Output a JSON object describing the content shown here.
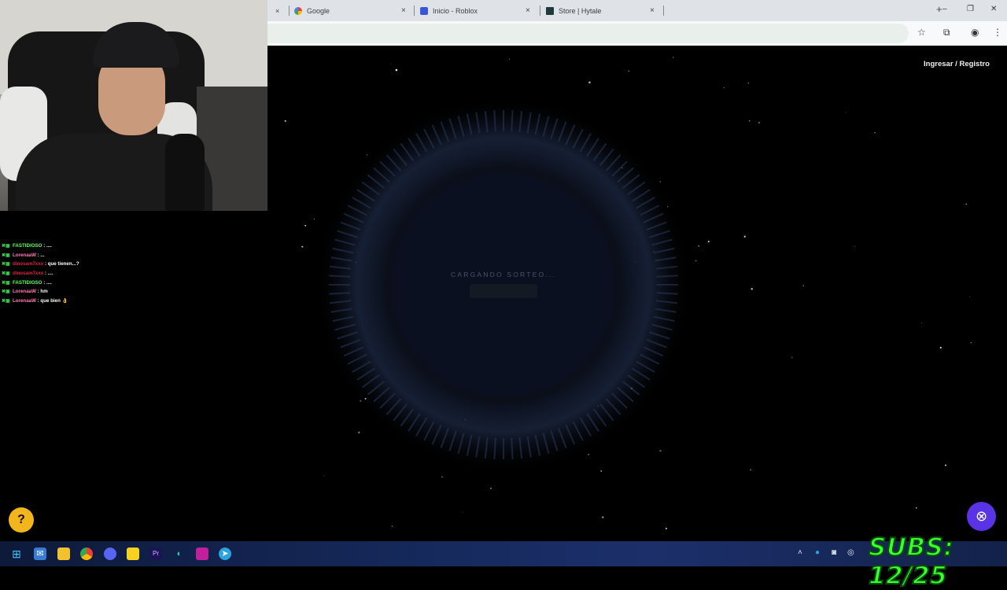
{
  "browser": {
    "tabs": [
      {
        "title": "Google"
      },
      {
        "title": "Inicio - Roblox"
      },
      {
        "title": "Store | Hytale"
      }
    ],
    "new_tab": "+",
    "window_controls": {
      "minimize": "–",
      "restore": "❐",
      "close": "✕"
    },
    "tab_close": "×",
    "toolbar_icons": {
      "bookmark": "☆",
      "extensions": "⧉",
      "profile": "◉",
      "menu": "⋮"
    }
  },
  "chat": [
    {
      "user": "FASTIDIOSO",
      "color": "#5cff5c",
      "message": ": ...."
    },
    {
      "user": "LorenaaW",
      "color": "#ff7ab0",
      "message": ": ..."
    },
    {
      "user": "dinosam7xxx",
      "color": "#e0203f",
      "message": ": que tienen...?"
    },
    {
      "user": "dinosam7xxx",
      "color": "#e0203f",
      "message": ": ...."
    },
    {
      "user": "FASTIDIOSO",
      "color": "#5cff5c",
      "message": ": ...."
    },
    {
      "user": "LorenaaW",
      "color": "#ff7ab0",
      "message": ": hm"
    },
    {
      "user": "LorenaaW",
      "color": "#ff7ab0",
      "message": ": que bien 👌"
    }
  ],
  "page": {
    "login_link": "Ingresar / Registro",
    "loader_text": "CARGANDO SORTEO..."
  },
  "help_icon": "?",
  "support_icon": "⊗",
  "overlay": {
    "subs": "SUBS: 12/25"
  },
  "colors": {
    "accent_green": "#39ff2e",
    "help_yellow": "#f2b51b",
    "support_purple": "#5b33e6"
  }
}
